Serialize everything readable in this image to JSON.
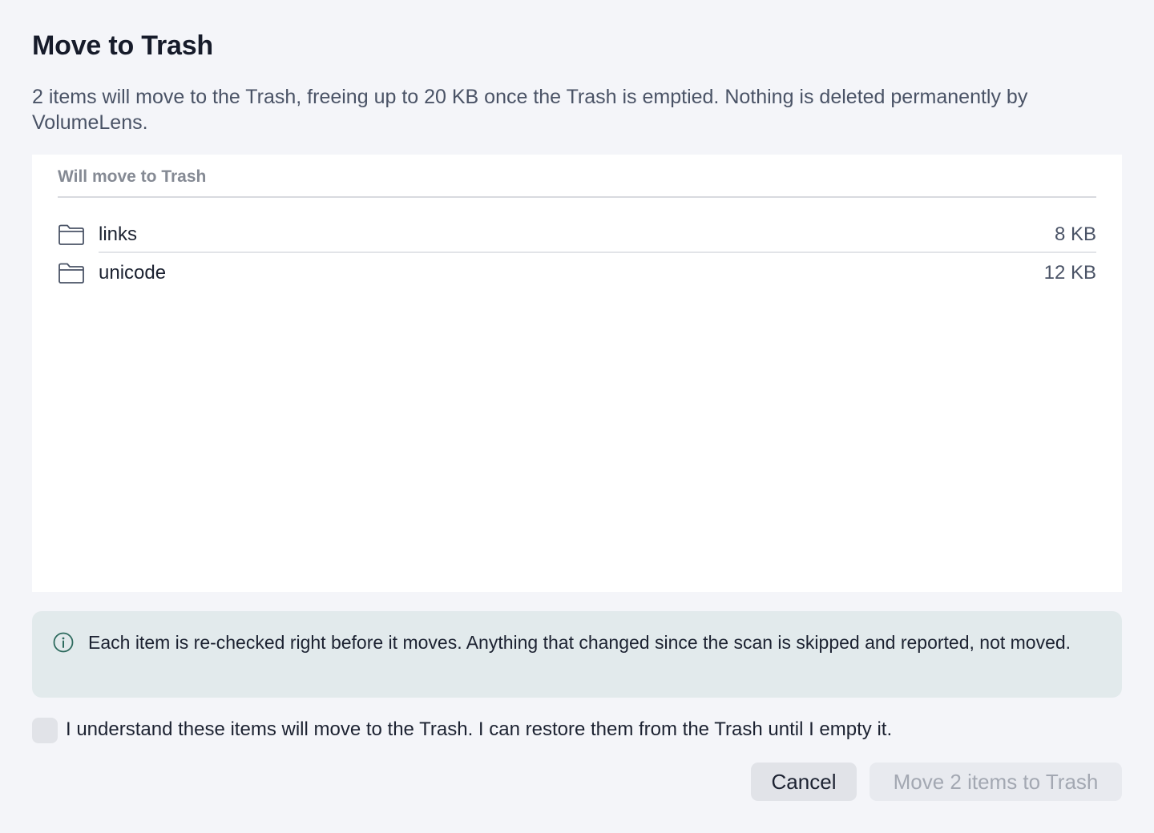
{
  "dialog": {
    "title": "Move to Trash",
    "description": "2 items will move to the Trash, freeing up to 20 KB once the Trash is emptied. Nothing is deleted permanently by VolumeLens."
  },
  "list": {
    "header": "Will move to Trash",
    "items": [
      {
        "name": "links",
        "size": "8 KB",
        "icon": "folder-icon"
      },
      {
        "name": "unicode",
        "size": "12 KB",
        "icon": "folder-icon"
      }
    ]
  },
  "notice": {
    "icon": "info-icon",
    "text": "Each item is re-checked right before it moves. Anything that changed since the scan is skipped and reported, not moved."
  },
  "confirm": {
    "label": "I understand these items will move to the Trash. I can restore them from the Trash until I empty it.",
    "checked": false
  },
  "buttons": {
    "cancel": "Cancel",
    "move": "Move 2 items to Trash",
    "move_disabled": true
  },
  "colors": {
    "background": "#f4f5f9",
    "notice_background": "#e2eaec",
    "info_icon": "#2e6b5e",
    "disabled_text": "#a3a8b2"
  }
}
